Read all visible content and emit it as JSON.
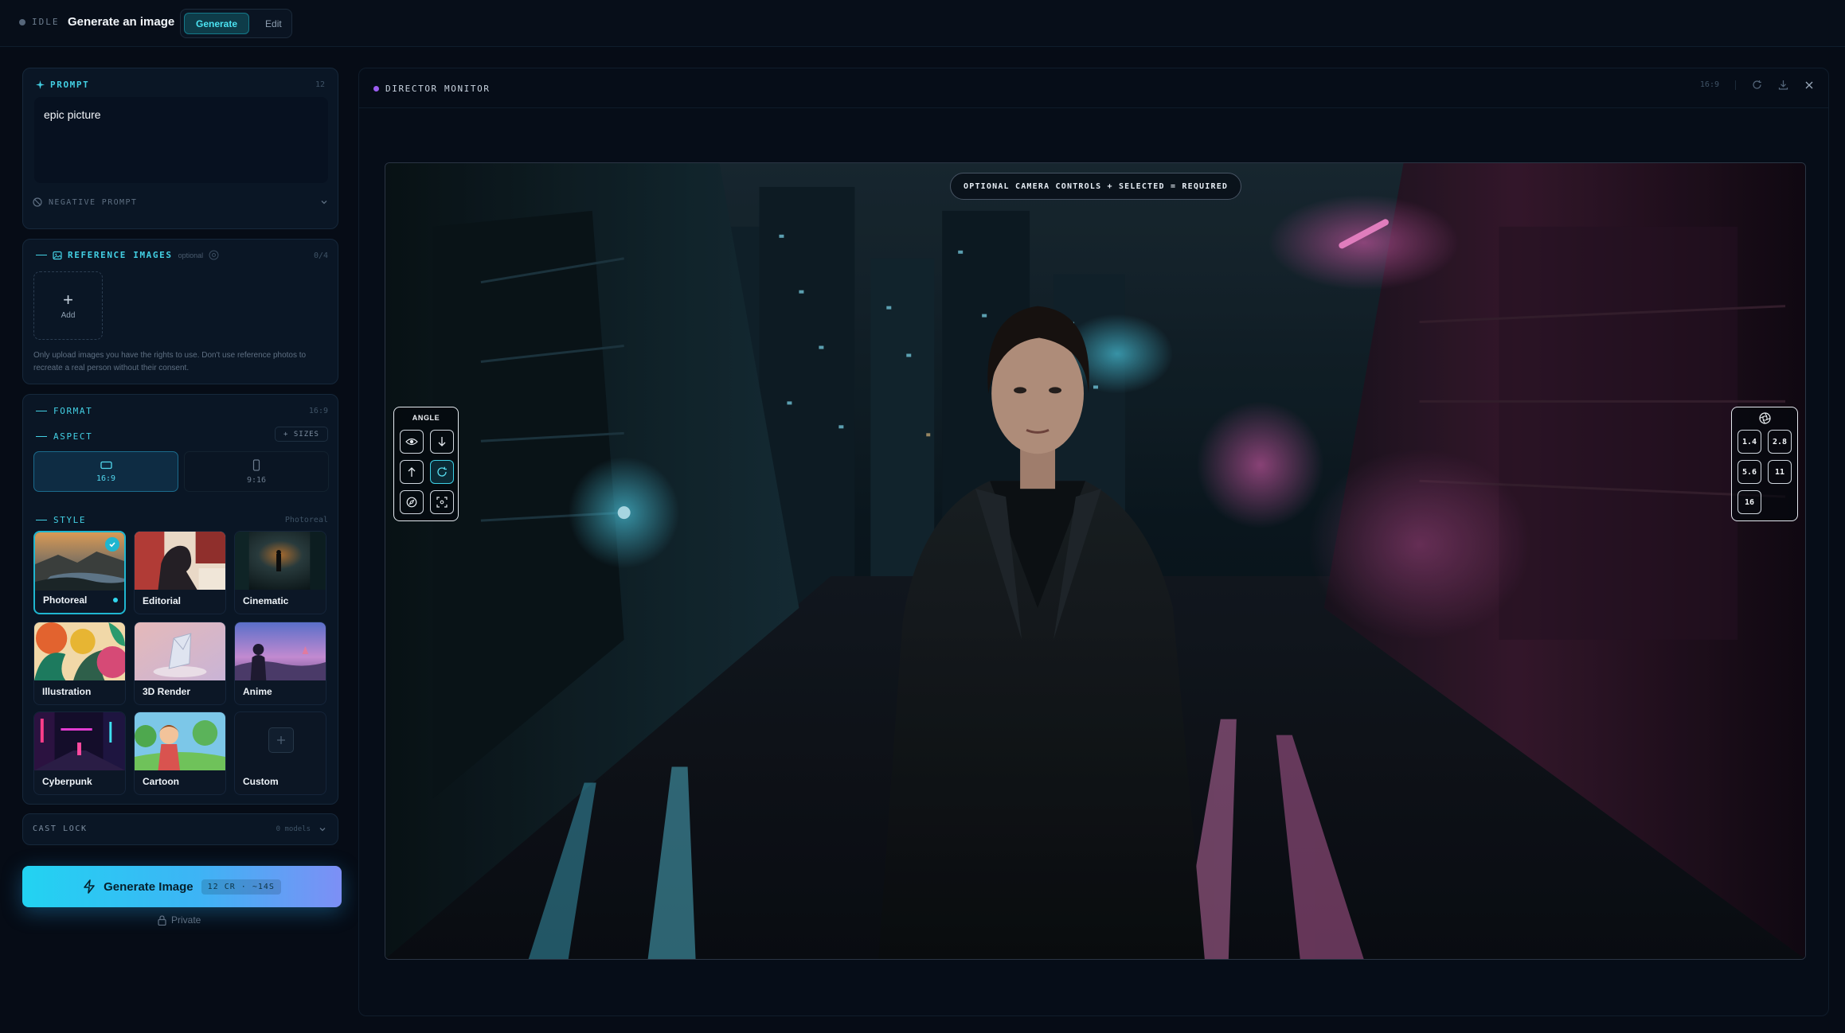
{
  "topbar": {
    "status": "IDLE",
    "title": "Generate an image",
    "modes": [
      "Generate",
      "Edit"
    ],
    "active_mode": "Generate"
  },
  "prompt": {
    "label": "PROMPT",
    "count": "12",
    "value": "epic picture",
    "negative_label": "NEGATIVE PROMPT"
  },
  "reference": {
    "label": "REFERENCE IMAGES",
    "optional": "optional",
    "count": "0/4",
    "add_label": "Add",
    "disclaimer": "Only upload images you have the rights to use. Don't use reference photos to recreate a real person without their consent."
  },
  "format": {
    "label": "FORMAT",
    "value": "16:9",
    "aspect_label": "ASPECT",
    "sizes_label": "+ SIZES",
    "aspects": [
      {
        "label": "16:9",
        "selected": true
      },
      {
        "label": "9:16",
        "selected": false
      }
    ]
  },
  "style": {
    "label": "STYLE",
    "selected": "Photoreal",
    "items": [
      {
        "name": "Photoreal"
      },
      {
        "name": "Editorial"
      },
      {
        "name": "Cinematic"
      },
      {
        "name": "Illustration"
      },
      {
        "name": "3D Render"
      },
      {
        "name": "Anime"
      },
      {
        "name": "Cyberpunk"
      },
      {
        "name": "Cartoon"
      },
      {
        "name": "Custom"
      }
    ]
  },
  "cast": {
    "label": "CAST LOCK",
    "count": "0 models"
  },
  "generate": {
    "label": "Generate Image",
    "cost": "12 CR · ~14S",
    "privacy": "Private"
  },
  "monitor": {
    "title": "DIRECTOR MONITOR",
    "ratio": "16:9",
    "camera_note": "OPTIONAL CAMERA CONTROLS + SELECTED = REQUIRED",
    "angle_label": "ANGLE",
    "apertures": [
      "1.4",
      "2.8",
      "5.6",
      "11",
      "16"
    ]
  },
  "colors": {
    "accent": "#43d0e4",
    "background": "#060c16",
    "panel": "#0a1625",
    "monitor_dot": "#9b5df0"
  },
  "icons": [
    "sparkle-icon",
    "ban-icon",
    "chevron-down-icon",
    "image-icon",
    "info-icon",
    "plus-icon",
    "landscape-icon",
    "portrait-icon",
    "check-icon",
    "bolt-icon",
    "lock-icon",
    "refresh-icon",
    "download-icon",
    "close-icon",
    "eye-icon",
    "arrow-down-icon",
    "arrow-up-icon",
    "rotate-icon",
    "compass-icon",
    "focus-icon",
    "aperture-icon"
  ]
}
